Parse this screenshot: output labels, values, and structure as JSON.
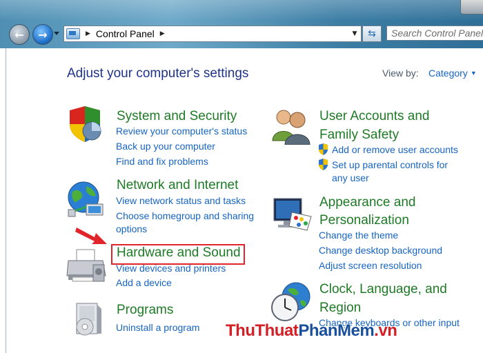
{
  "window": {
    "breadcrumb": "Control Panel",
    "search_placeholder": "Search Control Panel"
  },
  "header": {
    "title": "Adjust your computer's settings",
    "view_by_label": "View by:",
    "view_by_value": "Category"
  },
  "categories": {
    "system": {
      "title": "System and Security",
      "links": [
        "Review your computer's status",
        "Back up your computer",
        "Find and fix problems"
      ]
    },
    "network": {
      "title": "Network and Internet",
      "links": [
        "View network status and tasks",
        "Choose homegroup and sharing",
        "options"
      ]
    },
    "hardware": {
      "title": "Hardware and Sound",
      "links": [
        "View devices and printers",
        "Add a device"
      ]
    },
    "programs": {
      "title": "Programs",
      "links": [
        "Uninstall a program"
      ]
    },
    "users": {
      "title_line1": "User Accounts and",
      "title_line2": "Family Safety",
      "links": [
        "Add or remove user accounts",
        "Set up parental controls for",
        "any user"
      ]
    },
    "appearance": {
      "title_line1": "Appearance and",
      "title_line2": "Personalization",
      "links": [
        "Change the theme",
        "Change desktop background",
        "Adjust screen resolution"
      ]
    },
    "clock": {
      "title_line1": "Clock, Language, and",
      "title_line2": "Region",
      "links": [
        "Change keyboards or other input"
      ]
    }
  },
  "watermark": {
    "part1": "ThuThuat",
    "part2": "PhanMem",
    "part3": ".vn"
  },
  "colors": {
    "category_title": "#1e7a25",
    "link": "#1664c2",
    "page_title": "#1e3287",
    "highlight": "#e0242a"
  },
  "icons": {
    "system": "shield-icon",
    "network": "globe-network-icon",
    "hardware": "printer-icon",
    "programs": "programs-box-icon",
    "users": "users-icon",
    "appearance": "monitor-palette-icon",
    "clock": "clock-globe-icon",
    "arrow": "red-arrow-icon"
  }
}
